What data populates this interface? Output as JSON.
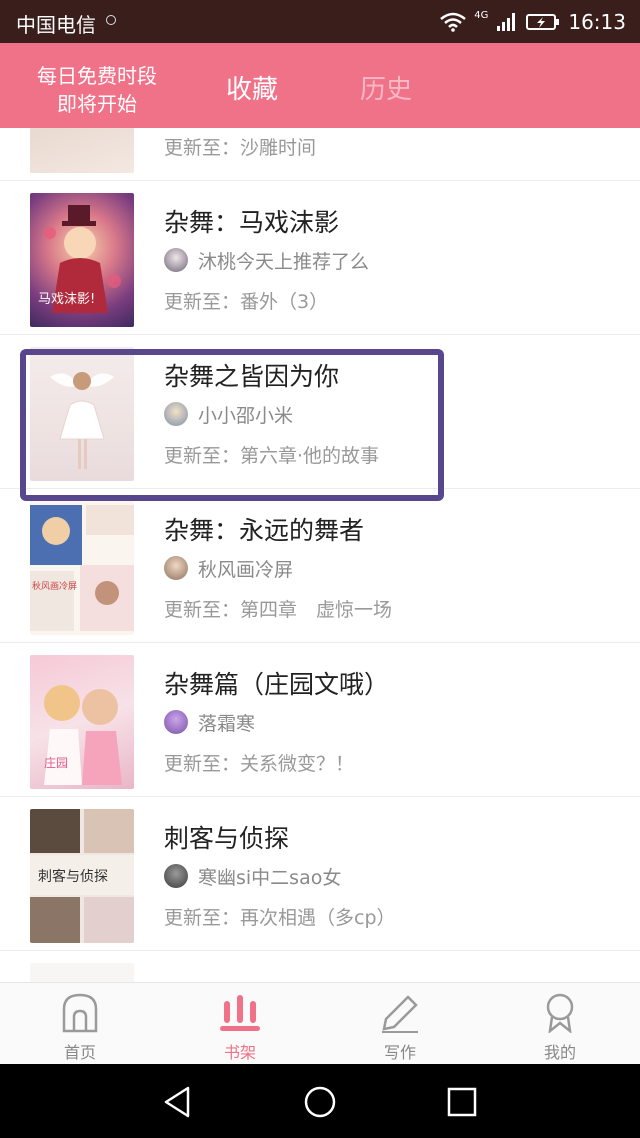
{
  "status_bar": {
    "carrier": "中国电信",
    "network": "4G",
    "time": "16:13"
  },
  "header": {
    "promo_line1": "每日免费时段",
    "promo_line2": "即将开始",
    "tabs": [
      {
        "label": "收藏",
        "active": true
      },
      {
        "label": "历史",
        "active": false
      }
    ]
  },
  "list": {
    "update_prefix": "更新至：",
    "items": [
      {
        "title": "",
        "author": "",
        "update": "沙雕时间",
        "partial": true
      },
      {
        "title": "杂舞：马戏沫影",
        "author": "沐桃今天上推荐了么",
        "update": "番外（3）"
      },
      {
        "title": "杂舞之皆因为你",
        "author": "小小邵小米",
        "update": "第六章·他的故事"
      },
      {
        "title": "杂舞：永远的舞者",
        "author": "秋风画冷屏",
        "update": "第四章　虚惊一场"
      },
      {
        "title": "杂舞篇（庄园文哦）",
        "author": "落霜寒",
        "update": "关系微变？！"
      },
      {
        "title": "刺客与侦探",
        "author": "寒幽si中二sao女",
        "update": "再次相遇（多cp）"
      }
    ]
  },
  "bottom_nav": [
    {
      "label": "首页",
      "icon": "home-icon",
      "active": false
    },
    {
      "label": "书架",
      "icon": "bookshelf-icon",
      "active": true
    },
    {
      "label": "写作",
      "icon": "pencil-icon",
      "active": false
    },
    {
      "label": "我的",
      "icon": "profile-icon",
      "active": false
    }
  ],
  "colors": {
    "brand": "#f07289",
    "highlight": "#58478c"
  }
}
